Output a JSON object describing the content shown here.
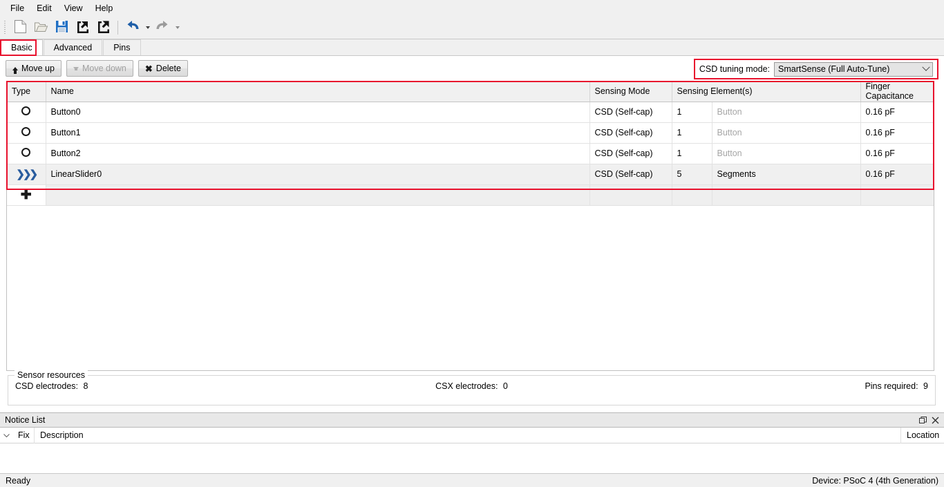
{
  "menubar": {
    "items": [
      {
        "label": "File"
      },
      {
        "label": "Edit"
      },
      {
        "label": "View"
      },
      {
        "label": "Help"
      }
    ]
  },
  "toolbar": {
    "buttons": [
      {
        "name": "new-file-icon",
        "title": "New"
      },
      {
        "name": "open-folder-icon",
        "title": "Open"
      },
      {
        "name": "save-icon",
        "title": "Save"
      },
      {
        "name": "import-icon",
        "title": "Import"
      },
      {
        "name": "export-icon",
        "title": "Export"
      },
      {
        "name": "undo-icon",
        "title": "Undo"
      },
      {
        "name": "redo-icon",
        "title": "Redo"
      }
    ]
  },
  "tabs": [
    {
      "label": "Basic",
      "active": true
    },
    {
      "label": "Advanced",
      "active": false
    },
    {
      "label": "Pins",
      "active": false
    }
  ],
  "actionbar": {
    "move_up_label": "Move up",
    "move_down_label": "Move down",
    "delete_label": "Delete",
    "tuning_label": "CSD tuning mode:",
    "tuning_value": "SmartSense (Full Auto-Tune)"
  },
  "grid": {
    "headers": {
      "type": "Type",
      "name": "Name",
      "sensing_mode": "Sensing Mode",
      "sensing_elements": "Sensing Element(s)",
      "finger_capacitance": "Finger Capacitance"
    },
    "rows": [
      {
        "type_icon": "circle-icon",
        "name": "Button0",
        "sensing_mode": "CSD (Self-cap)",
        "element_count": "1",
        "element_kind": "Button",
        "element_kind_dim": true,
        "finger_capacitance": "0.16 pF",
        "selected": false
      },
      {
        "type_icon": "circle-icon",
        "name": "Button1",
        "sensing_mode": "CSD (Self-cap)",
        "element_count": "1",
        "element_kind": "Button",
        "element_kind_dim": true,
        "finger_capacitance": "0.16 pF",
        "selected": false
      },
      {
        "type_icon": "circle-icon",
        "name": "Button2",
        "sensing_mode": "CSD (Self-cap)",
        "element_count": "1",
        "element_kind": "Button",
        "element_kind_dim": true,
        "finger_capacitance": "0.16 pF",
        "selected": false
      },
      {
        "type_icon": "slider-icon",
        "name": "LinearSlider0",
        "sensing_mode": "CSD (Self-cap)",
        "element_count": "5",
        "element_kind": "Segments",
        "element_kind_dim": false,
        "finger_capacitance": "0.16 pF",
        "selected": true
      }
    ],
    "add_row_icon": "plus-icon"
  },
  "resources": {
    "legend": "Sensor resources",
    "csd_label": "CSD electrodes:",
    "csd_value": "8",
    "csx_label": "CSX electrodes:",
    "csx_value": "0",
    "pins_label": "Pins required:",
    "pins_value": "9"
  },
  "notice": {
    "title": "Notice List",
    "float_icon": "float-window-icon",
    "close_icon": "close-icon",
    "columns": {
      "fix": "Fix",
      "description": "Description",
      "location": "Location"
    }
  },
  "statusbar": {
    "status": "Ready",
    "device": "Device: PSoC 4 (4th Generation)"
  },
  "colors": {
    "highlight_red": "#e8112d",
    "accent_blue": "#2a5d9f",
    "panel_grey": "#f0f0f0"
  }
}
